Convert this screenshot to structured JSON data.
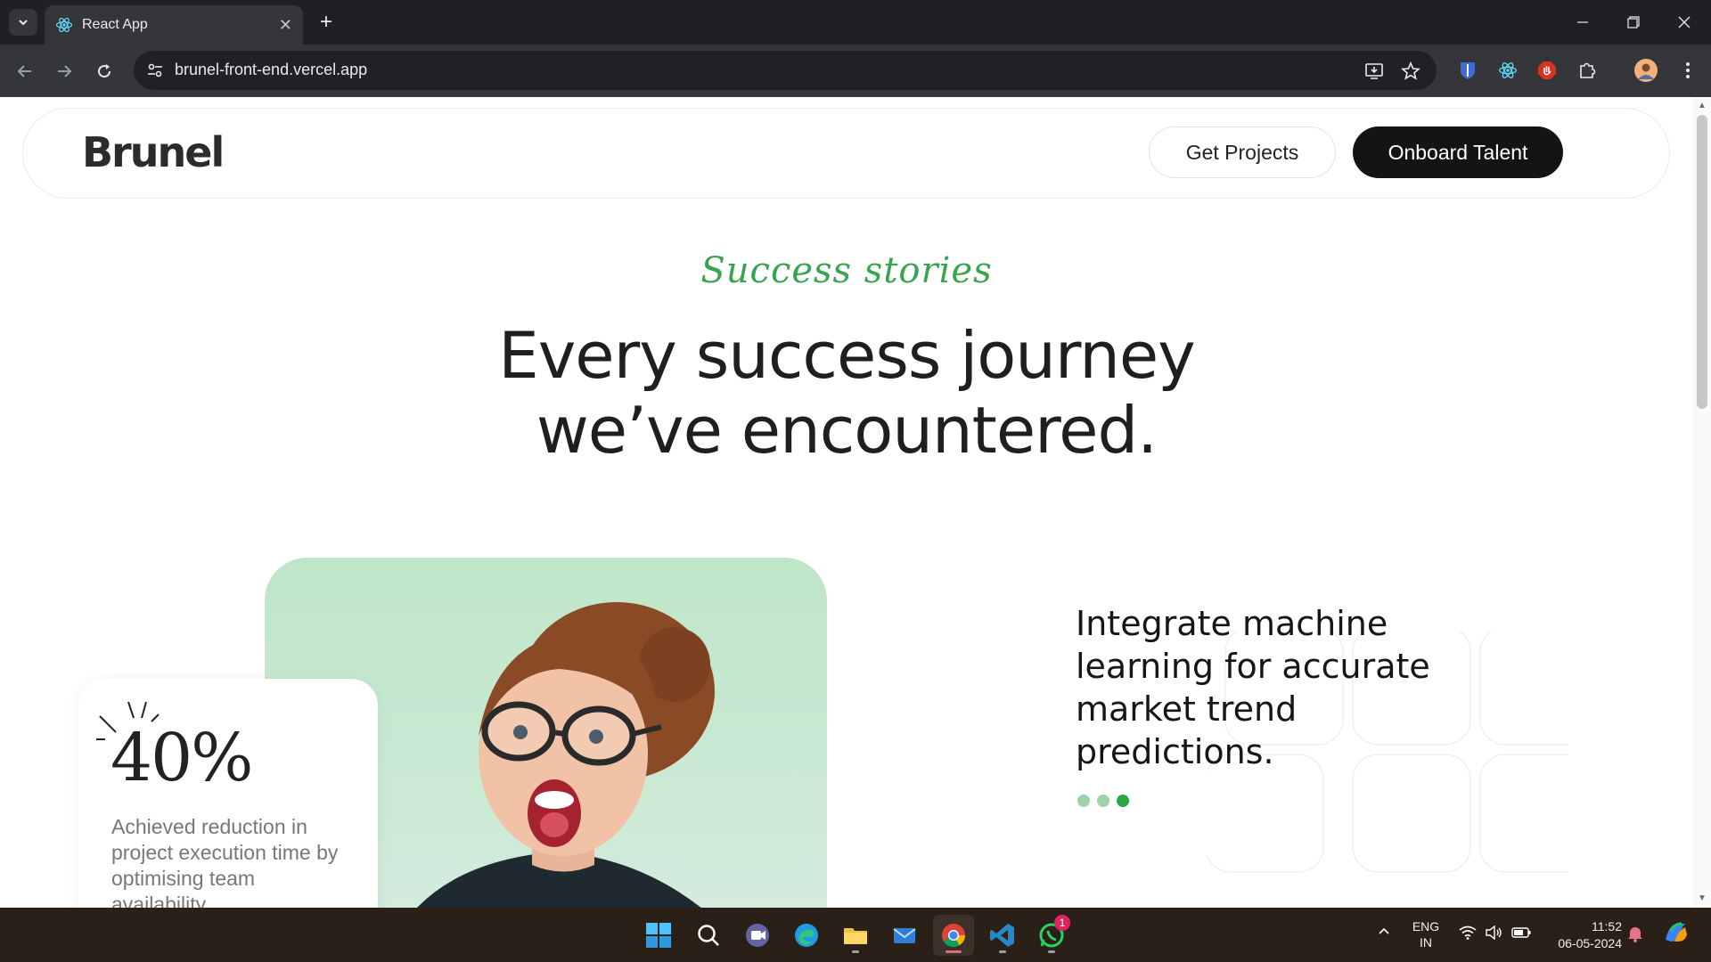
{
  "browser": {
    "tab": {
      "title": "React App"
    },
    "omnibox": {
      "url": "brunel-front-end.vercel.app"
    }
  },
  "site": {
    "logo": "Brunel",
    "nav": {
      "get_projects": "Get Projects",
      "onboard_talent": "Onboard Talent"
    },
    "hero": {
      "eyebrow": "Success stories",
      "headline_line1": "Every success journey",
      "headline_line2": "we’ve encountered."
    },
    "stat": {
      "value": "40%",
      "description": "Achieved reduction in project execution time by optimising team availability"
    },
    "testimonial": {
      "text": "Integrate machine learning for accurate market trend predictions.",
      "dots": 3,
      "active_dot": 3
    },
    "colors": {
      "accent_green": "#3aa34e",
      "dark_button": "#141414"
    }
  },
  "taskbar": {
    "apps": [
      "start-icon",
      "search-icon",
      "teams-icon",
      "edge-icon",
      "file-explorer-icon",
      "mail-icon",
      "chrome-icon",
      "vscode-icon",
      "whatsapp-icon"
    ],
    "whatsapp_badge": "1",
    "language": "ENG",
    "region": "IN",
    "time": "11:52",
    "date": "06-05-2024"
  }
}
